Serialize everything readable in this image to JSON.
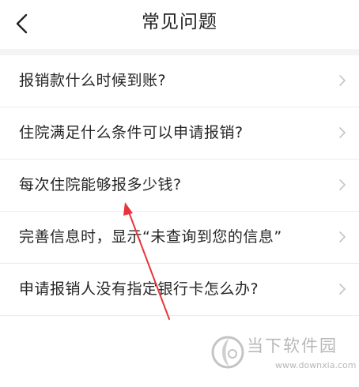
{
  "header": {
    "title": "常见问题",
    "back_icon": "chevron-left-icon"
  },
  "faq_items": [
    {
      "label": "报销款什么时候到账?"
    },
    {
      "label": "住院满足什么条件可以申请报销?"
    },
    {
      "label": "每次住院能够报多少钱?"
    },
    {
      "label": "完善信息时，显示“未查询到您的信息”"
    },
    {
      "label": "申请报销人没有指定银行卡怎么办?"
    }
  ],
  "watermark": {
    "name": "当下软件园",
    "url": "www.downxia.com"
  },
  "colors": {
    "background": "#ffffff",
    "section_gap": "#f4f4f4",
    "divider": "#ececec",
    "chevron": "#c4c4c4",
    "annotation_arrow": "#e8343a",
    "watermark": "#b8b8b8"
  }
}
